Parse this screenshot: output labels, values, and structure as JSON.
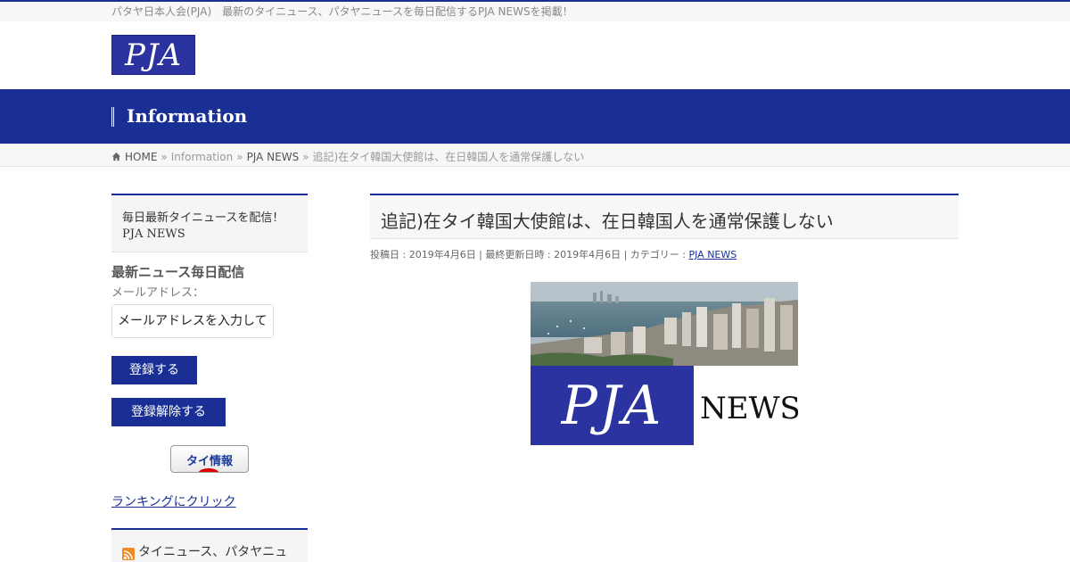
{
  "site": {
    "tagline": "パタヤ日本人会(PJA)　最新のタイニュース、パタヤニュースを毎日配信するPJA NEWSを掲載！",
    "logo_text": "PJA",
    "accent_color": "#1a2f96"
  },
  "hero": {
    "title": "Information"
  },
  "breadcrumb": {
    "home": "HOME",
    "sep": "»",
    "level1": "Information",
    "level2": "PJA NEWS",
    "current": "追記)在タイ韓国大使館は、在日韓国人を通常保護しない"
  },
  "sidebar": {
    "box_line1": "毎日最新タイニュースを配信！",
    "box_line2": "PJA NEWS",
    "subscribe_heading": "最新ニュース毎日配信",
    "email_label": "メールアドレス：",
    "email_placeholder": "メールアドレスを入力して",
    "subscribe_button": "登録する",
    "unsubscribe_button": "登録解除する",
    "banner_text": "タイ情報",
    "ranking_link": "ランキングにクリック",
    "rss_title": "タイニュース、パタヤニュ"
  },
  "post": {
    "title": "追記)在タイ韓国大使館は、在日韓国人を通常保護しない",
    "meta_prefix": "投稿日 : 2019年4月6日 | 最終更新日時 : 2019年4月6日 | カテゴリー : ",
    "category": "PJA NEWS",
    "image_logo": "PJA",
    "image_word": "NEWS"
  }
}
